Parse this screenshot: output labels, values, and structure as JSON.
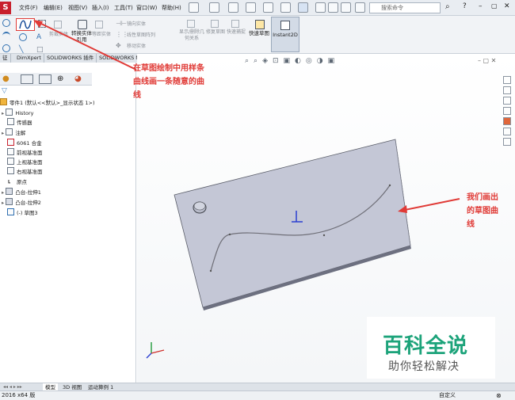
{
  "menubar": {
    "logo": "S",
    "items": [
      "文件(F)",
      "编辑(E)",
      "视图(V)",
      "插入(I)",
      "工具(T)",
      "窗口(W)",
      "帮助(H)"
    ],
    "search_placeholder": "搜索命令"
  },
  "command_manager": {
    "small_items": [
      "镜向实体",
      "线性草图阵列",
      "移动实体"
    ],
    "items": [
      "剪裁实体",
      "转换实体引用",
      "等距实体",
      "显示/删除几何关系",
      "修复草图",
      "快速捕捉",
      "快速草图",
      "Instant2D"
    ]
  },
  "feature_tabs": [
    "征",
    "DimXpert",
    "SOLIDWORKS 插件",
    "SOLIDWORKS MBD"
  ],
  "feature_tree": {
    "root": "零件1 (默认<<默认>_显示状态 1>)",
    "items": [
      "History",
      "传感器",
      "注解",
      "6061 合金",
      "前视基准面",
      "上视基准面",
      "右视基准面",
      "原点",
      "凸台-拉伸1",
      "凸台-拉伸2",
      "(-) 草图3"
    ]
  },
  "annotations": {
    "top_note": [
      "在草图绘制中用样条",
      "曲线画一条随意的曲",
      "线"
    ],
    "right_note": [
      "我们画出",
      "的草图曲",
      "线"
    ]
  },
  "watermark": {
    "title": "百科全说",
    "subtitle": "助你轻松解决"
  },
  "bottom_tabs": [
    "模型",
    "3D 视图",
    "运动算例 1"
  ],
  "statusbar": {
    "left": "2016 x64 版",
    "right": "自定义"
  },
  "colors": {
    "annotation_red": "#e03a36",
    "plate_face": "#c4c7d6",
    "watermark_green": "#1ca37a",
    "logo_red": "#c8202c"
  }
}
